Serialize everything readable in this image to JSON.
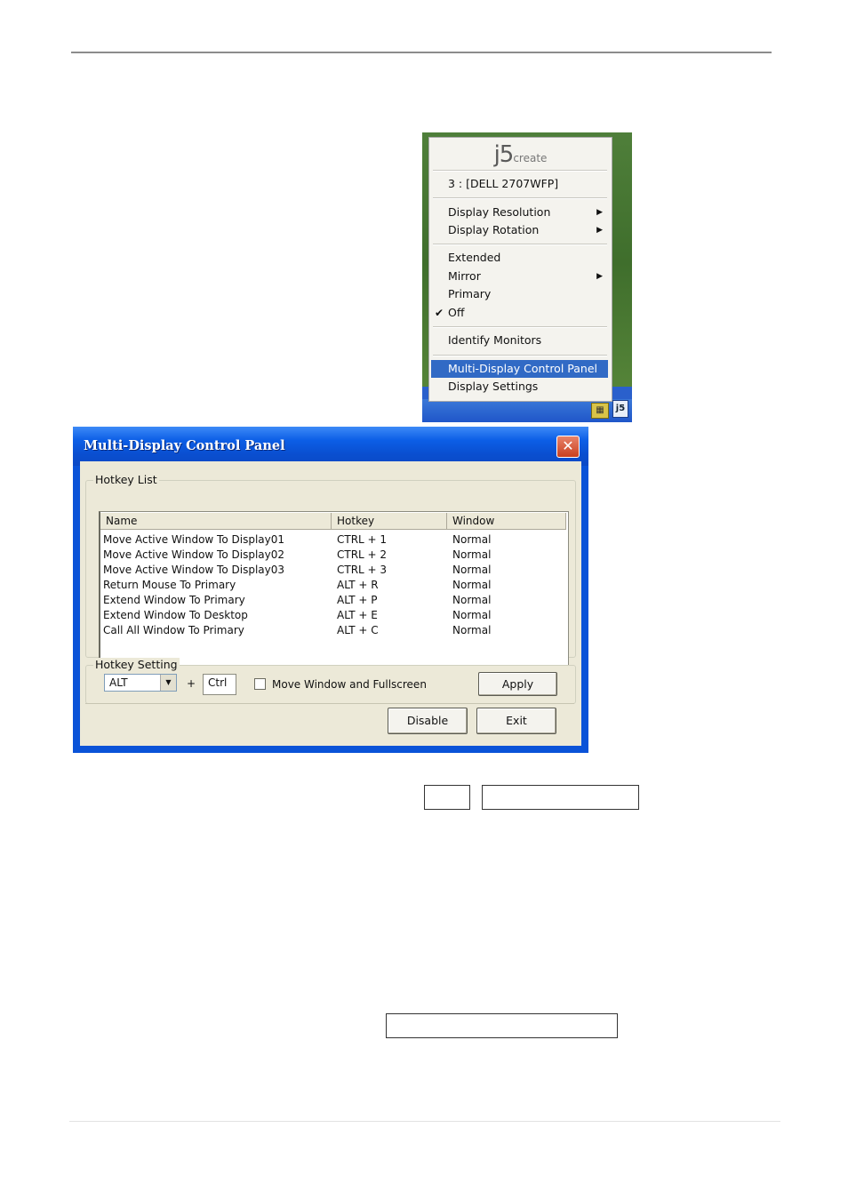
{
  "tray_menu": {
    "logo_main": "j5",
    "logo_sub": "create",
    "monitor": "3 : [DELL 2707WFP]",
    "items": {
      "display_resolution": "Display Resolution",
      "display_rotation": "Display Rotation",
      "extended": "Extended",
      "mirror": "Mirror",
      "primary": "Primary",
      "off": "Off",
      "identify": "Identify Monitors",
      "control_panel": "Multi-Display Control Panel",
      "display_settings": "Display Settings"
    },
    "checked_item": "Off",
    "tray_icon_label": "j5"
  },
  "dialog": {
    "title": "Multi-Display Control Panel",
    "close_glyph": "✕",
    "hotkey_list_label": "Hotkey List",
    "columns": [
      "Name",
      "Hotkey",
      "Window"
    ],
    "rows": [
      [
        "Move Active Window To Display01",
        "CTRL + 1",
        "Normal"
      ],
      [
        "Move Active Window To Display02",
        "CTRL + 2",
        "Normal"
      ],
      [
        "Move Active Window To Display03",
        "CTRL + 3",
        "Normal"
      ],
      [
        "Return Mouse To Primary",
        "ALT + R",
        "Normal"
      ],
      [
        "Extend Window To Primary",
        "ALT + P",
        "Normal"
      ],
      [
        "Extend Window To Desktop",
        "ALT + E",
        "Normal"
      ],
      [
        "Call All Window To Primary",
        "ALT + C",
        "Normal"
      ]
    ],
    "hotkey_setting_label": "Hotkey Setting",
    "modifier_value": "ALT",
    "plus": "+",
    "key_value": "Ctrl",
    "checkbox_label": "Move Window and Fullscreen",
    "checkbox_checked": false,
    "apply": "Apply",
    "disable": "Disable",
    "exit": "Exit"
  },
  "colors": {
    "titlebar": "#0a53d8",
    "menu_highlight": "#316ac5",
    "dialog_face": "#ece9d8"
  }
}
